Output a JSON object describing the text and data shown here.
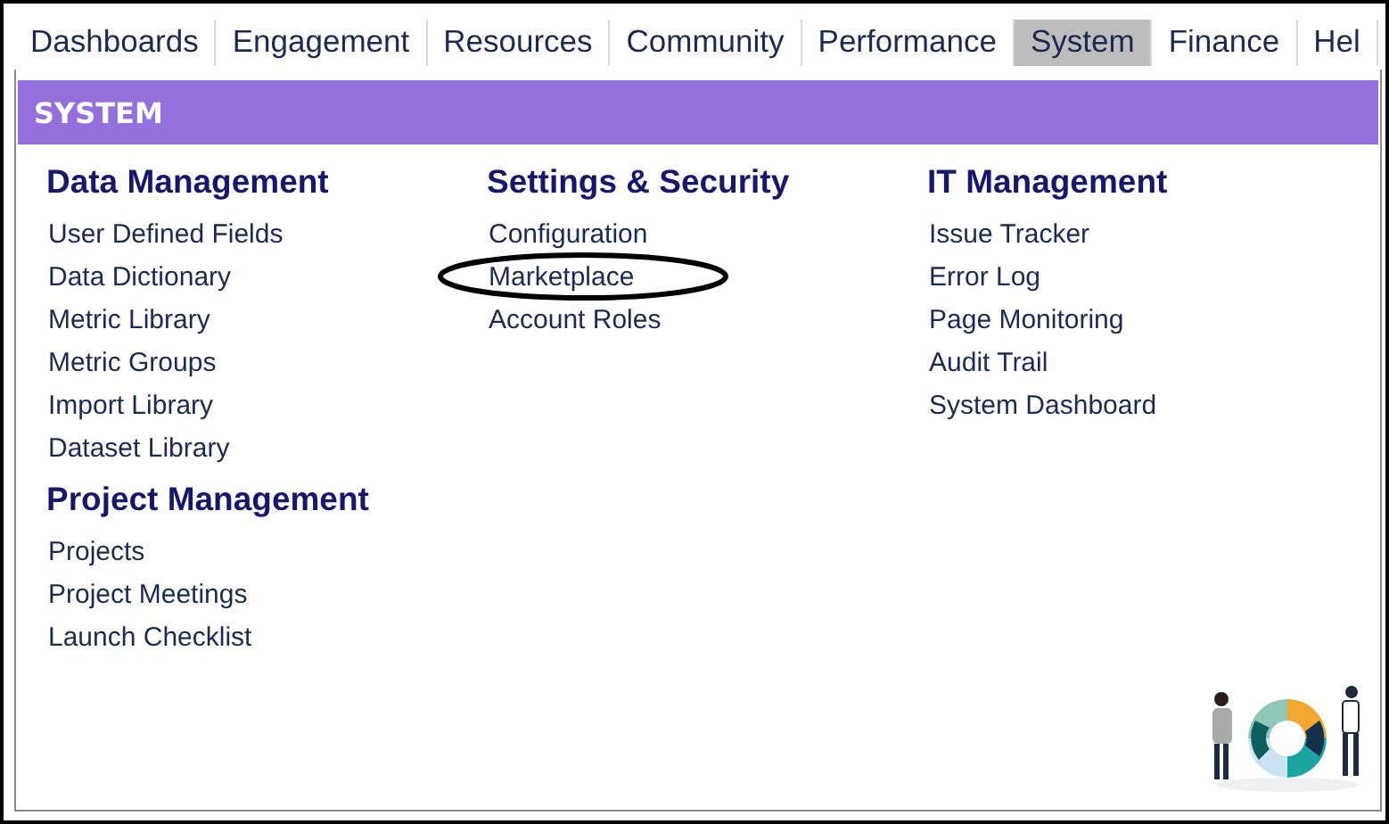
{
  "tabs": [
    {
      "label": "Dashboards",
      "selected": false
    },
    {
      "label": "Engagement",
      "selected": false
    },
    {
      "label": "Resources",
      "selected": false
    },
    {
      "label": "Community",
      "selected": false
    },
    {
      "label": "Performance",
      "selected": false
    },
    {
      "label": "System",
      "selected": true
    },
    {
      "label": "Finance",
      "selected": false
    },
    {
      "label": "Hel",
      "selected": false
    }
  ],
  "menu": {
    "title": "SYSTEM",
    "columns": [
      {
        "sections": [
          {
            "heading": "Data Management",
            "items": [
              {
                "label": "User Defined Fields",
                "circled": false
              },
              {
                "label": "Data Dictionary",
                "circled": false
              },
              {
                "label": "Metric Library",
                "circled": false
              },
              {
                "label": "Metric Groups",
                "circled": false
              },
              {
                "label": "Import Library",
                "circled": false
              },
              {
                "label": "Dataset Library",
                "circled": false
              }
            ]
          },
          {
            "heading": "Project Management",
            "items": [
              {
                "label": "Projects",
                "circled": false
              },
              {
                "label": "Project Meetings",
                "circled": false
              },
              {
                "label": "Launch Checklist",
                "circled": false
              }
            ]
          }
        ]
      },
      {
        "sections": [
          {
            "heading": "Settings & Security",
            "items": [
              {
                "label": "Configuration",
                "circled": false
              },
              {
                "label": "Marketplace",
                "circled": true
              },
              {
                "label": "Account Roles",
                "circled": false
              }
            ]
          }
        ]
      },
      {
        "sections": [
          {
            "heading": "IT Management",
            "items": [
              {
                "label": "Issue Tracker",
                "circled": false
              },
              {
                "label": "Error Log",
                "circled": false
              },
              {
                "label": "Page Monitoring",
                "circled": false
              },
              {
                "label": "Audit Trail",
                "circled": false
              },
              {
                "label": "System Dashboard",
                "circled": false
              }
            ]
          }
        ]
      }
    ]
  }
}
